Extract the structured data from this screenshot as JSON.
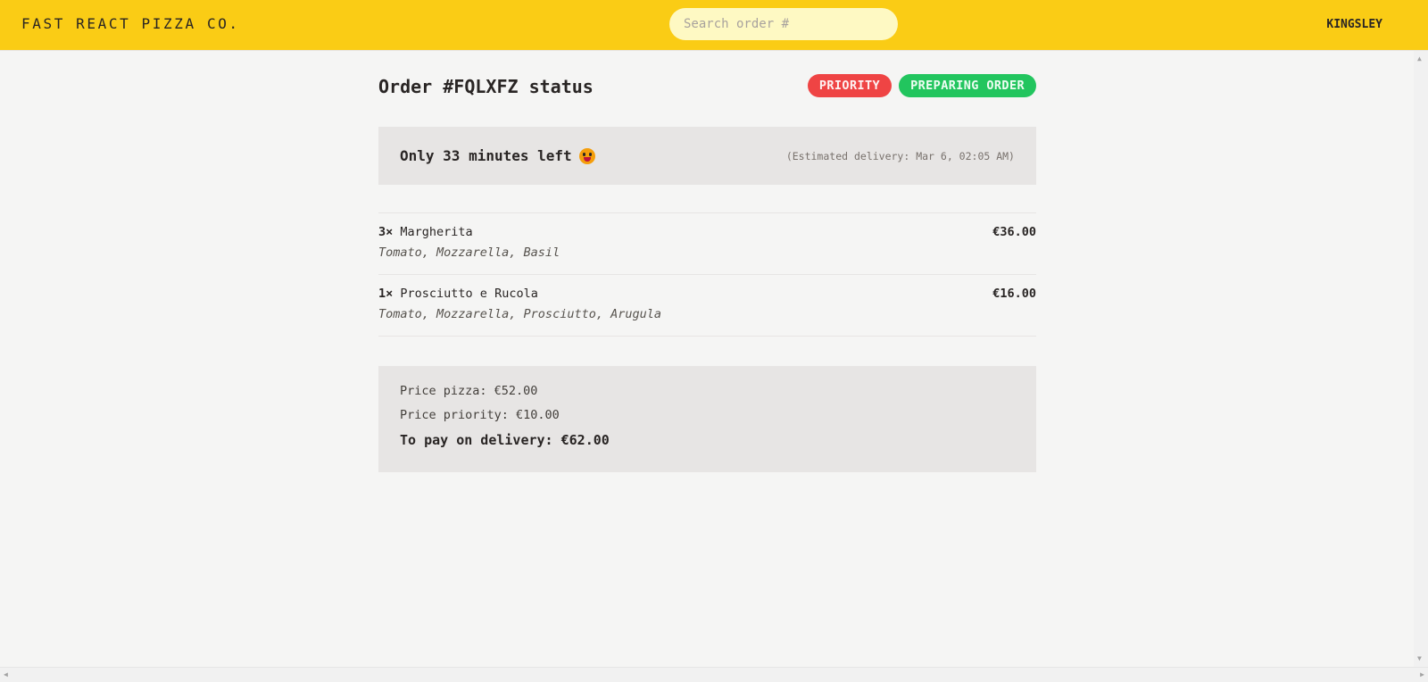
{
  "header": {
    "logo": "Fast React Pizza Co.",
    "search_placeholder": "Search order #",
    "username": "KINGSLEY"
  },
  "order": {
    "title": "Order #FQLXFZ status",
    "badges": {
      "priority": "Priority",
      "status": "Preparing order"
    },
    "eta": {
      "message": "Only 33 minutes left",
      "emoji": "smiling-face-icon",
      "estimated": "(Estimated delivery: Mar 6, 02:05 AM)"
    },
    "items": [
      {
        "qty": "3×",
        "name": "Margherita",
        "price": "€36.00",
        "ingredients": "Tomato, Mozzarella, Basil"
      },
      {
        "qty": "1×",
        "name": "Prosciutto e Rucola",
        "price": "€16.00",
        "ingredients": "Tomato, Mozzarella, Prosciutto, Arugula"
      }
    ],
    "summary": {
      "price_pizza": "Price pizza: €52.00",
      "price_priority": "Price priority: €10.00",
      "total": "To pay on delivery: €62.00"
    }
  },
  "colors": {
    "header_bg": "#facc15",
    "priority_badge": "#ef4444",
    "status_badge": "#22c55e",
    "panel_bg": "#e7e5e4"
  }
}
